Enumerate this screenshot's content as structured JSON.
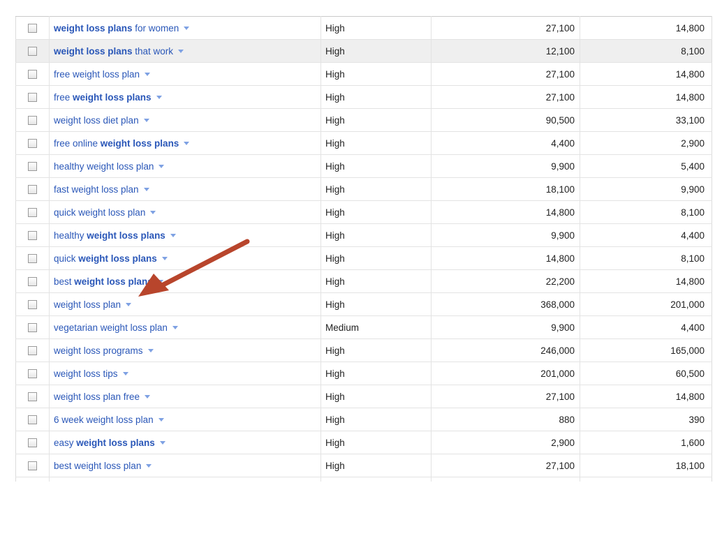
{
  "colors": {
    "link": "#2a57b8",
    "arrow": "#b8452c",
    "row_highlight": "#efefef"
  },
  "rows": [
    {
      "pre": "",
      "bold": "weight loss plans",
      "post": " for women",
      "competition": "High",
      "global": "27,100",
      "local": "14,800"
    },
    {
      "pre": "",
      "bold": "weight loss plans",
      "post": " that work",
      "competition": "High",
      "global": "12,100",
      "local": "8,100"
    },
    {
      "pre": "free weight loss plan",
      "bold": "",
      "post": "",
      "competition": "High",
      "global": "27,100",
      "local": "14,800"
    },
    {
      "pre": "free ",
      "bold": "weight loss plans",
      "post": "",
      "competition": "High",
      "global": "27,100",
      "local": "14,800"
    },
    {
      "pre": "weight loss diet plan",
      "bold": "",
      "post": "",
      "competition": "High",
      "global": "90,500",
      "local": "33,100"
    },
    {
      "pre": "free online ",
      "bold": "weight loss plans",
      "post": "",
      "competition": "High",
      "global": "4,400",
      "local": "2,900"
    },
    {
      "pre": "healthy weight loss plan",
      "bold": "",
      "post": "",
      "competition": "High",
      "global": "9,900",
      "local": "5,400"
    },
    {
      "pre": "fast weight loss plan",
      "bold": "",
      "post": "",
      "competition": "High",
      "global": "18,100",
      "local": "9,900"
    },
    {
      "pre": "quick weight loss plan",
      "bold": "",
      "post": "",
      "competition": "High",
      "global": "14,800",
      "local": "8,100"
    },
    {
      "pre": "healthy ",
      "bold": "weight loss plans",
      "post": "",
      "competition": "High",
      "global": "9,900",
      "local": "4,400"
    },
    {
      "pre": "quick ",
      "bold": "weight loss plans",
      "post": "",
      "competition": "High",
      "global": "14,800",
      "local": "8,100"
    },
    {
      "pre": "best ",
      "bold": "weight loss plans",
      "post": "",
      "competition": "High",
      "global": "22,200",
      "local": "14,800"
    },
    {
      "pre": "weight loss plan",
      "bold": "",
      "post": "",
      "competition": "High",
      "global": "368,000",
      "local": "201,000"
    },
    {
      "pre": "vegetarian weight loss plan",
      "bold": "",
      "post": "",
      "competition": "Medium",
      "global": "9,900",
      "local": "4,400"
    },
    {
      "pre": "weight loss programs",
      "bold": "",
      "post": "",
      "competition": "High",
      "global": "246,000",
      "local": "165,000"
    },
    {
      "pre": "weight loss tips",
      "bold": "",
      "post": "",
      "competition": "High",
      "global": "201,000",
      "local": "60,500"
    },
    {
      "pre": "weight loss plan free",
      "bold": "",
      "post": "",
      "competition": "High",
      "global": "27,100",
      "local": "14,800"
    },
    {
      "pre": "6 week weight loss plan",
      "bold": "",
      "post": "",
      "competition": "High",
      "global": "880",
      "local": "390"
    },
    {
      "pre": "easy ",
      "bold": "weight loss plans",
      "post": "",
      "competition": "High",
      "global": "2,900",
      "local": "1,600"
    },
    {
      "pre": "best weight loss plan",
      "bold": "",
      "post": "",
      "competition": "High",
      "global": "27,100",
      "local": "18,100"
    }
  ],
  "highlighted_row": 1,
  "annotation": {
    "type": "arrow",
    "points_to_row": 12
  }
}
